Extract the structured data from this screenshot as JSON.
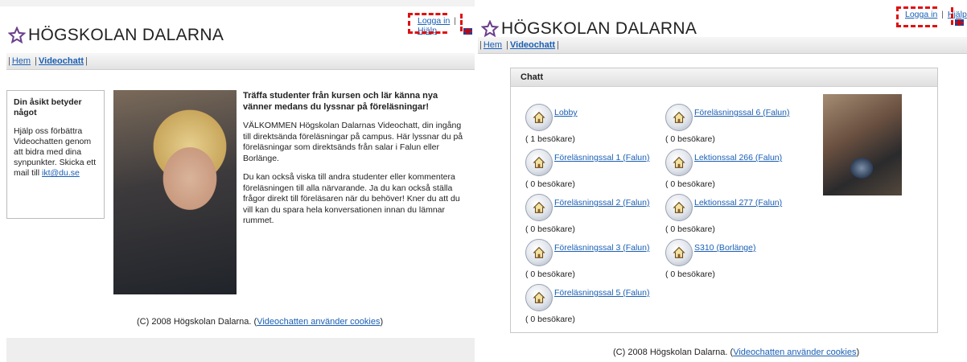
{
  "left": {
    "brand": "HÖGSKOLAN DALARNA",
    "top_links": {
      "login": "Logga in",
      "separator": "|",
      "help": "Hjälp"
    },
    "nav": {
      "home": "Hem",
      "separator": "|",
      "videochat": "Videochatt"
    },
    "opinion": {
      "title": "Din åsikt betyder något",
      "text": "Hjälp oss förbättra Videochatten genom att bidra med dina synpunkter. Skicka ett mail till",
      "email": "ikt@du.se"
    },
    "welcome": {
      "heading": "Träffa studenter från kursen och lär känna nya vänner medans du lyssnar på föreläsningar!",
      "para1": "VÄLKOMMEN Högskolan Dalarnas Videochatt, din ingång till direktsända föreläsningar på campus. Här lyssnar du på föreläsningar som direktsänds från salar i Falun eller Borlänge.",
      "para2": "Du kan också viska till andra studenter eller kommentera föreläsningen till alla närvarande. Ja du kan också ställa frågor direkt till föreläsaren när du behöver!  Kner du att du vill kan du spara hela konversationen innan du lämnar rummet."
    },
    "footer": {
      "copyright": "(C) 2008 Högskolan Dalarna. (",
      "cookie_link": "Videochatten använder cookies",
      "close": ")"
    }
  },
  "right": {
    "brand": "HÖGSKOLAN DALARNA",
    "top_links": {
      "login": "Logga in",
      "separator": "|",
      "help": "Hjälp"
    },
    "nav": {
      "home": "Hem",
      "separator": "|",
      "videochat": "Videochatt"
    },
    "chat_title": "Chatt",
    "rooms_col1": [
      {
        "name": "Lobby",
        "visitors": "( 1 besökare)"
      },
      {
        "name": "Föreläsningssal 1 (Falun)",
        "visitors": "( 0 besökare)"
      },
      {
        "name": "Föreläsningssal 2 (Falun)",
        "visitors": "( 0 besökare)"
      },
      {
        "name": "Föreläsningssal 3 (Falun)",
        "visitors": "( 0 besökare)"
      },
      {
        "name": "Föreläsningssal 5 (Falun)",
        "visitors": "( 0 besökare)"
      }
    ],
    "rooms_col2": [
      {
        "name": "Föreläsningssal 6 (Falun)",
        "visitors": "( 0 besökare)"
      },
      {
        "name": "Lektionssal 266 (Falun)",
        "visitors": "( 0 besökare)"
      },
      {
        "name": "Lektionssal 277 (Falun)",
        "visitors": "( 0 besökare)"
      },
      {
        "name": "S310 (Borlänge)",
        "visitors": "( 0 besökare)"
      }
    ],
    "footer": {
      "copyright": "(C) 2008 Högskolan Dalarna. (",
      "cookie_link": "Videochatten använder cookies",
      "close": ")"
    }
  },
  "colors": {
    "link": "#1a5fb4",
    "highlight_dash": "#e01010",
    "star": "#6b3f8c"
  },
  "icons": [
    "star-logo-icon",
    "uk-flag-icon",
    "home-icon"
  ]
}
